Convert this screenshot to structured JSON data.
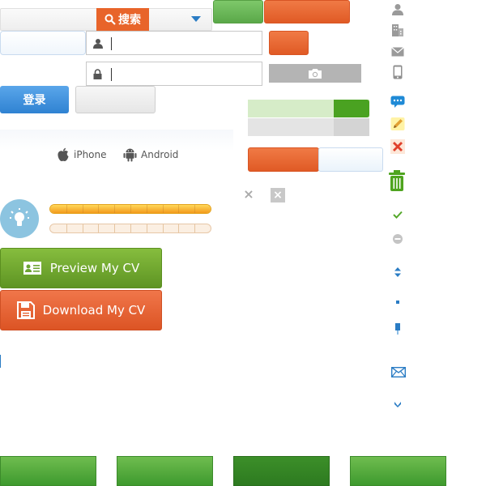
{
  "search": {
    "button_label": "搜索"
  },
  "login": {
    "button_label": "登录"
  },
  "platforms": [
    {
      "label": "iPhone",
      "icon": "apple-icon"
    },
    {
      "label": "Android",
      "icon": "android-icon"
    }
  ],
  "cv_buttons": {
    "preview_label": "Preview My CV",
    "download_label": "Download My CV"
  },
  "progress": {
    "completion": 0.29
  },
  "rating": {
    "filled_fraction": 1.0,
    "second_filled_fraction": 0.0,
    "segments": 10
  },
  "colors": {
    "orange": "#e8642a",
    "green": "#4aa221",
    "blue": "#2f82d2",
    "icon_gray": "#9a9a9a",
    "icon_blue": "#2a7cc4"
  },
  "sidebar_icons": [
    "user-icon",
    "building-icon",
    "mail-icon",
    "phone-icon",
    "chat-icon",
    "pencil-icon",
    "delete-icon",
    "trash-icon",
    "check-icon",
    "minus-icon",
    "sort-icon",
    "dot-icon",
    "small-pin-icon",
    "envelope-outline-icon",
    "chevron-small-icon"
  ]
}
